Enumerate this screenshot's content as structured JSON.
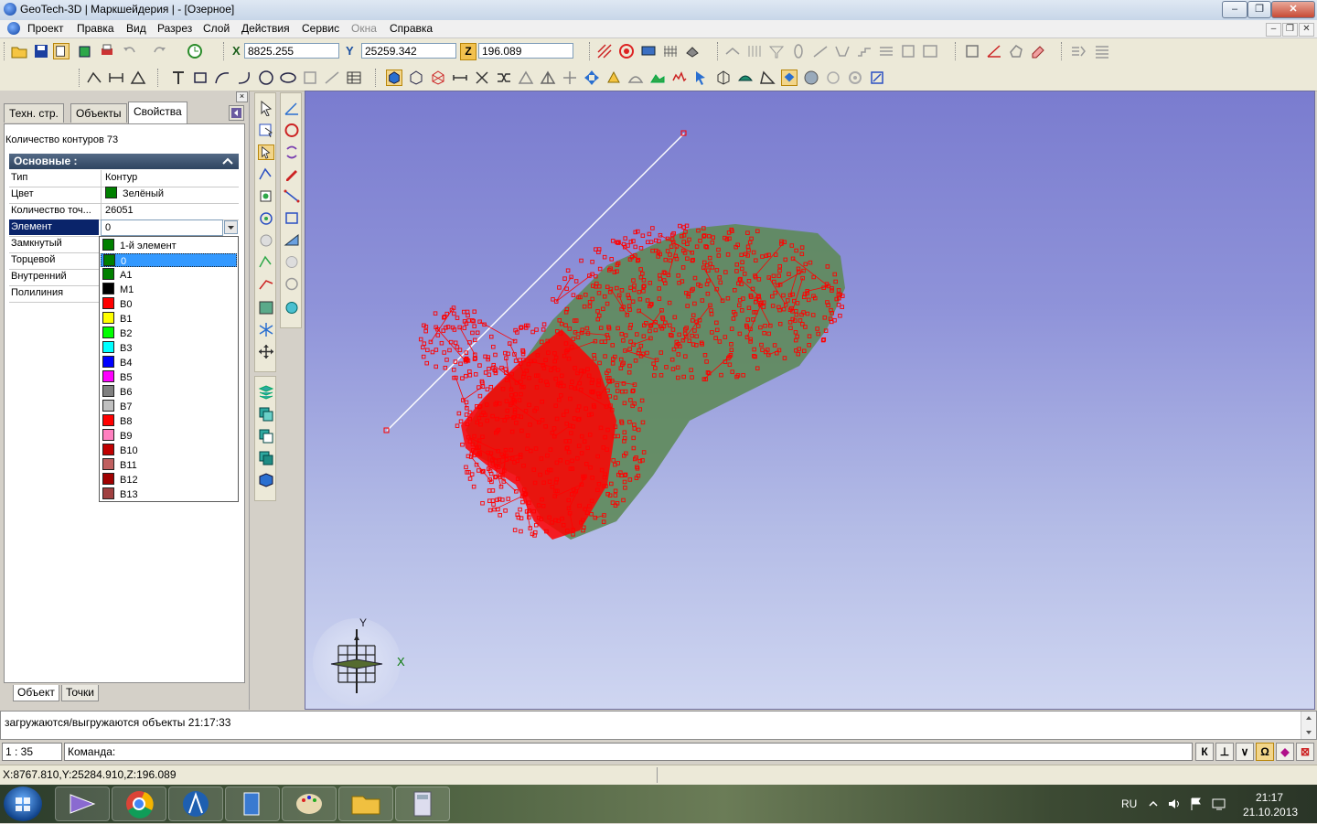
{
  "window": {
    "title": "GeoTech-3D | Маркшейдерия | - [Озерное]",
    "controls": {
      "minimize": "–",
      "maximize": "❐",
      "close": "✕"
    }
  },
  "menu": {
    "items": [
      "Проект",
      "Правка",
      "Вид",
      "Разрез",
      "Слой",
      "Действия",
      "Сервис",
      "Окна",
      "Справка"
    ],
    "disabled_item": "Окна",
    "mdi_controls": [
      "–",
      "❐",
      "✕"
    ]
  },
  "coords": {
    "x_label": "X",
    "x_value": "8825.255",
    "y_label": "Y",
    "y_value": "25259.342",
    "z_label": "Z",
    "z_value": "196.089"
  },
  "left_panel": {
    "tabs": [
      "Техн. стр.",
      "Объекты",
      "Свойства"
    ],
    "active_tab": "Свойства",
    "contour_count": "Количество контуров 73",
    "group_header": "Основные :",
    "properties": [
      {
        "key": "Тип",
        "value": "Контур"
      },
      {
        "key": "Цвет",
        "value": "Зелёный",
        "swatch": "#008000"
      },
      {
        "key": "Количество точ...",
        "value": "26051"
      },
      {
        "key": "Элемент",
        "value": "0"
      },
      {
        "key": "Замкнутый",
        "value": ""
      },
      {
        "key": "Торцевой",
        "value": ""
      },
      {
        "key": "Внутренний",
        "value": ""
      },
      {
        "key": "Полилиния",
        "value": ""
      }
    ],
    "dropdown_items": [
      {
        "label": "1-й элемент",
        "color": "#008000"
      },
      {
        "label": "0",
        "color": "#008000"
      },
      {
        "label": "A1",
        "color": "#008000"
      },
      {
        "label": "M1",
        "color": "#000000"
      },
      {
        "label": "B0",
        "color": "#ff0000"
      },
      {
        "label": "B1",
        "color": "#ffff00"
      },
      {
        "label": "B2",
        "color": "#00ff00"
      },
      {
        "label": "B3",
        "color": "#00ffff"
      },
      {
        "label": "B4",
        "color": "#0000ff"
      },
      {
        "label": "B5",
        "color": "#ff00ff"
      },
      {
        "label": "B6",
        "color": "#808080"
      },
      {
        "label": "B7",
        "color": "#c0c0c0"
      },
      {
        "label": "B8",
        "color": "#ff0000"
      },
      {
        "label": "B9",
        "color": "#ff80c0"
      },
      {
        "label": "B10",
        "color": "#c00000"
      },
      {
        "label": "B11",
        "color": "#c06060"
      },
      {
        "label": "B12",
        "color": "#a00000"
      },
      {
        "label": "B13",
        "color": "#a04040"
      }
    ],
    "selected_item": "0",
    "bottom_tabs": [
      "Объект",
      "Точки"
    ]
  },
  "viewport": {
    "axis_y": "Y",
    "axis_x": "X",
    "mesh_color": "#ff0000",
    "surface_color": "#5e8a5a"
  },
  "messages": {
    "log": "загружаются/выгружаются объекты 21:17:33"
  },
  "command": {
    "scale": "1 : 35",
    "prompt": "Команда:",
    "buttons": [
      "К",
      "⊥",
      "∨",
      "Ω",
      "◆",
      "⊠"
    ]
  },
  "status": {
    "cursor": "X:8767.810,Y:25284.910,Z:196.089"
  },
  "tray": {
    "lang": "RU",
    "time": "21:17",
    "date": "21.10.2013"
  }
}
